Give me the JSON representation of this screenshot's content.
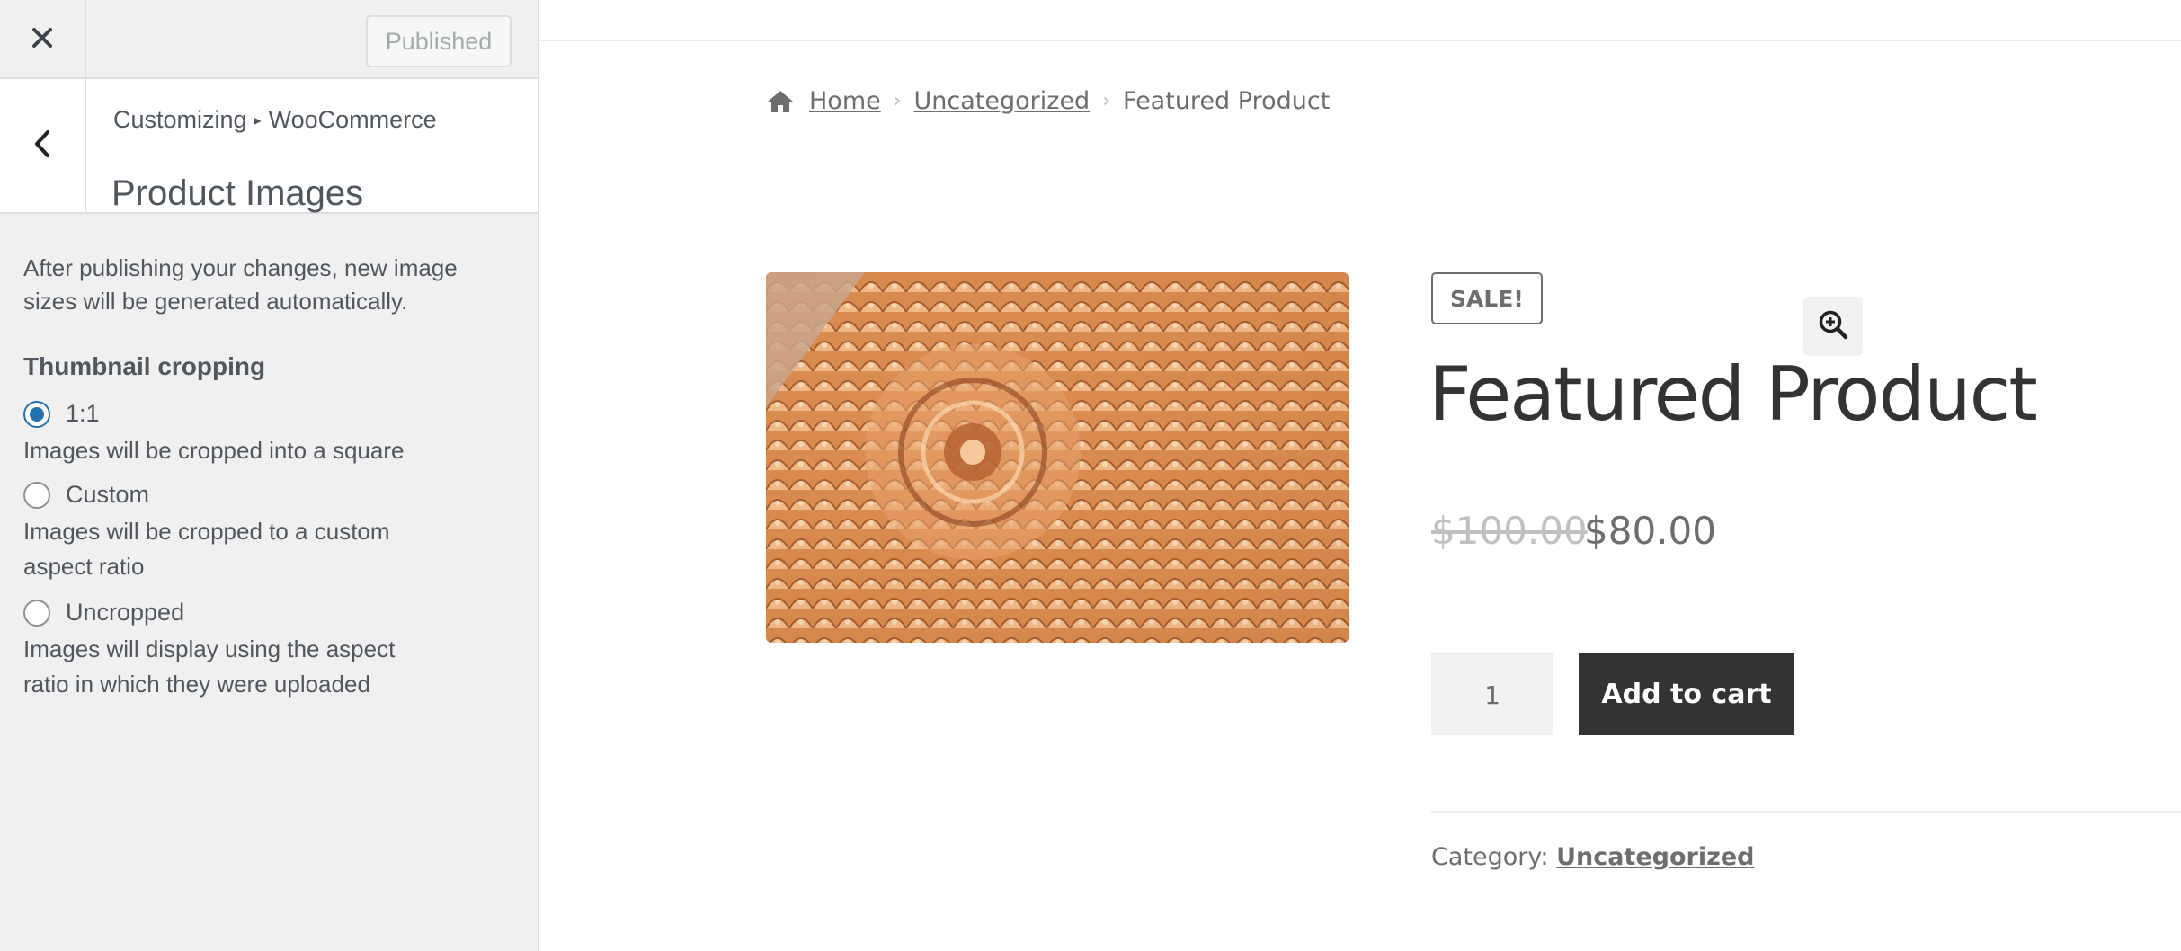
{
  "customizer": {
    "close_icon": "close-icon",
    "publish_label": "Published",
    "back_icon": "chevron-left-icon",
    "breadcrumb_prefix": "Customizing",
    "breadcrumb_separator": "▸",
    "breadcrumb_section": "WooCommerce",
    "title": "Product Images",
    "description": "After publishing your changes, new image sizes will be generated automatically.",
    "thumbnail_heading": "Thumbnail cropping",
    "options": [
      {
        "label": "1:1",
        "description": "Images will be cropped into a square",
        "checked": true
      },
      {
        "label": "Custom",
        "description": "Images will be cropped to a custom aspect ratio",
        "checked": false
      },
      {
        "label": "Uncropped",
        "description": "Images will display using the aspect ratio in which they were uploaded",
        "checked": false
      }
    ]
  },
  "preview": {
    "breadcrumbs": {
      "home_icon": "home-icon",
      "home": "Home",
      "category": "Uncategorized",
      "current": "Featured Product",
      "separator_icon": "chevron-right-icon"
    },
    "zoom_icon": "zoom-in-icon",
    "sale_badge": "SALE!",
    "product_title": "Featured Product",
    "price_old": "$100.00",
    "price_new": "$80.00",
    "quantity": "1",
    "add_to_cart": "Add to cart",
    "category_label": "Category:",
    "category_value": "Uncategorized"
  },
  "colors": {
    "accent": "#2271b1",
    "button_dark": "#333333",
    "sidebar_bg": "#f0f0f1"
  }
}
